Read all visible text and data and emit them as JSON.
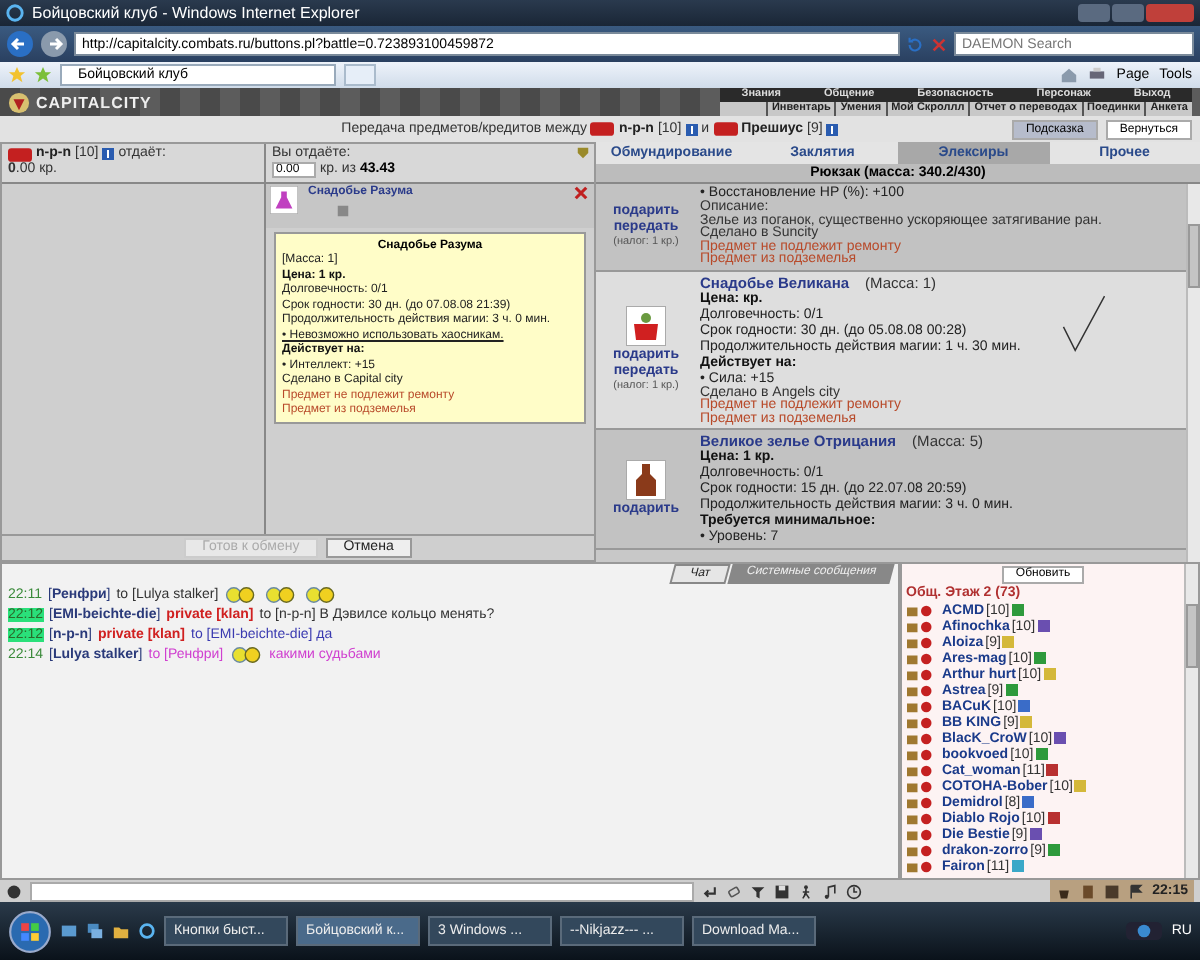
{
  "browser": {
    "title": "Бойцовский клуб - Windows Internet Explorer",
    "url": "http://capitalcity.combats.ru/buttons.pl?battle=0.723893100459872",
    "search_placeholder": "DAEMON Search",
    "tab": "Бойцовский клуб",
    "tools": [
      "Page",
      "Tools"
    ]
  },
  "game": {
    "logo": "CAPITALCITY",
    "nav_top": [
      "Знания",
      "Общение",
      "Безопасность",
      "Персонаж",
      "Выход"
    ],
    "nav_bottom": [
      "Инвентарь",
      "Умения",
      "Мой Скроллл",
      "Отчет о переводах",
      "Поединки",
      "Анкета"
    ]
  },
  "transfer": {
    "title": "Передача предметов/кредитов между",
    "user1": {
      "name": "n-p-n",
      "level": "[10]"
    },
    "conj": "и",
    "user2": {
      "name": "Прешиус",
      "level": "[9]"
    },
    "buttons": [
      "Подсказка",
      "Вернуться"
    ]
  },
  "partner": {
    "name": "n-p-n",
    "level": "[10]",
    "label": "отдаёт:",
    "amount": "**0**.00 кр."
  },
  "mine": {
    "label": "Вы отдаёте:",
    "value": "0.00",
    "of_label": "кр. из",
    "balance": "43.43",
    "item": "Снадобье Разума",
    "tooltip": {
      "title": "Снадобье Разума",
      "lines": [
        {
          "kind": "plain",
          "text": "[Масса: 1]"
        },
        {
          "kind": "bold",
          "text": "Цена: 1 кр."
        },
        {
          "kind": "plain",
          "text": "Долговечность: 0/1"
        },
        {
          "kind": "plain",
          "text": "Срок годности: 30 дн. (до 07.08.08 21:39)"
        },
        {
          "kind": "plain",
          "text": "Продолжительность действия магии: 3 ч. 0 мин."
        },
        {
          "kind": "underline",
          "text": "• Невозможно использовать хаосникам."
        },
        {
          "kind": "bold",
          "text": "Действует на:"
        },
        {
          "kind": "plain",
          "text": "• Интеллект: +15"
        },
        {
          "kind": "plain",
          "text": "Сделано в Capital city"
        },
        {
          "kind": "red",
          "text": "Предмет не подлежит ремонту"
        },
        {
          "kind": "red",
          "text": "Предмет из подземелья"
        }
      ]
    }
  },
  "trade_buttons": [
    {
      "label": "Готов к обмену",
      "disabled": true
    },
    {
      "label": "Отмена",
      "disabled": false
    }
  ],
  "inventory": {
    "tabs": [
      {
        "label": "Обмундирование",
        "selected": false
      },
      {
        "label": "Заклятия",
        "selected": false
      },
      {
        "label": "Элексиры",
        "selected": true
      },
      {
        "label": "Прочее",
        "selected": false
      }
    ],
    "header": "Рюкзак (масса: 340.2/430)",
    "items": [
      {
        "kind": "plain",
        "actions": [
          "подарить",
          "передать"
        ],
        "tax": "(налог: 1 кр.)",
        "checked": false,
        "lines": [
          {
            "kind": "plain",
            "text": "• Восстановление HP (%): +100"
          },
          {
            "kind": "small",
            "text": "Описание:"
          },
          {
            "kind": "small",
            "text": "Зелье из поганок, существенно ускоряющее затягивание ран."
          },
          {
            "kind": "small",
            "text": "Сделано в Suncity"
          },
          {
            "kind": "red",
            "text": "Предмет не подлежит ремонту"
          },
          {
            "kind": "red",
            "text": "Предмет из подземелья"
          }
        ]
      },
      {
        "name": "Снадобье Великана",
        "mass": "(Масса: 1)",
        "kind": "bag",
        "actions": [
          "подарить",
          "передать"
        ],
        "tax": "(налог: 1 кр.)",
        "checked": true,
        "lines": [
          {
            "kind": "bold",
            "text": "Цена: кр."
          },
          {
            "kind": "plain",
            "text": "Долговечность: 0/1"
          },
          {
            "kind": "plain",
            "text": "Срок годности: 30 дн. (до 05.08.08 00:28)"
          },
          {
            "kind": "plain",
            "text": "Продолжительность действия магии: 1 ч. 30 мин."
          },
          {
            "kind": "bold",
            "text": "Действует на:"
          },
          {
            "kind": "plain",
            "text": "• Сила: +15"
          },
          {
            "kind": "small",
            "text": "Сделано в Angels city"
          },
          {
            "kind": "red",
            "text": "Предмет не подлежит ремонту"
          },
          {
            "kind": "red",
            "text": "Предмет из подземелья"
          }
        ]
      },
      {
        "name": "Великое зелье Отрицания",
        "mass": "(Масса: 5)",
        "kind": "bottle",
        "actions": [
          "подарить"
        ],
        "checked": false,
        "lines": [
          {
            "kind": "bold",
            "text": "Цена: 1 кр."
          },
          {
            "kind": "plain",
            "text": "Долговечность: 0/1"
          },
          {
            "kind": "plain",
            "text": "Срок годности: 15 дн. (до 22.07.08 20:59)"
          },
          {
            "kind": "plain",
            "text": "Продолжительность действия магии: 3 ч. 0 мин."
          },
          {
            "kind": "bold",
            "text": "Требуется минимальное:"
          },
          {
            "kind": "plain",
            "text": "• Уровень: 7"
          }
        ]
      }
    ]
  },
  "chat": {
    "tabs": [
      {
        "label": "Чат",
        "selected": true
      },
      {
        "label": "Системные сообщения",
        "selected": false
      }
    ],
    "messages": [
      {
        "time": "22:11",
        "highlighted": false,
        "parts": [
          {
            "kind": "name",
            "text": "[**Ренфри**]"
          },
          {
            "kind": "text",
            "text": "to [Lulya stalker]"
          },
          {
            "kind": "smiley"
          },
          {
            "kind": "smiley"
          },
          {
            "kind": "smiley"
          }
        ]
      },
      {
        "time": "22:12",
        "highlighted": true,
        "parts": [
          {
            "kind": "name",
            "text": "[**EMI-beichte-die**]"
          },
          {
            "kind": "private",
            "text": "private [klan]"
          },
          {
            "kind": "text",
            "text": "to [n-p-n] В Дэвилсе кольцо менять?"
          }
        ]
      },
      {
        "time": "22:12",
        "highlighted": true,
        "parts": [
          {
            "kind": "name",
            "text": "[**n-p-n**]"
          },
          {
            "kind": "private",
            "text": "private [klan]"
          },
          {
            "kind": "blue",
            "text": "to [EMI-beichte-die] да"
          }
        ]
      },
      {
        "time": "22:14",
        "highlighted": false,
        "parts": [
          {
            "kind": "name",
            "text": "[**Lulya stalker**]"
          },
          {
            "kind": "pink",
            "text": "to [Ренфри]"
          },
          {
            "kind": "smiley"
          },
          {
            "kind": "pink",
            "text": "какими судьбами"
          }
        ]
      }
    ]
  },
  "users": {
    "refresh": "Обновить",
    "room": "Общ. Этаж 2 (73)",
    "list": [
      {
        "name": "ACMD",
        "level": "[10]",
        "color": "#2e9a3c"
      },
      {
        "name": "Afinochka",
        "level": "[10]",
        "color": "#6a4fb0"
      },
      {
        "name": "Aloiza",
        "level": "[9]",
        "color": "#d4b83a"
      },
      {
        "name": "Ares-mag",
        "level": "[10]",
        "color": "#2e9a3c"
      },
      {
        "name": "Arthur hurt",
        "level": "[10]",
        "color": "#d4b83a"
      },
      {
        "name": "Astrea",
        "level": "[9]",
        "color": "#2e9a3c"
      },
      {
        "name": "BACuK",
        "level": "[10]",
        "color": "#3a6cc8"
      },
      {
        "name": "BB KING",
        "level": "[9]",
        "color": "#d4b83a"
      },
      {
        "name": "BlacK_CroW",
        "level": "[10]",
        "color": "#6a4fb0"
      },
      {
        "name": "bookvoed",
        "level": "[10]",
        "color": "#2e9a3c"
      },
      {
        "name": "Cat_woman",
        "level": "[11]",
        "color": "#b83030"
      },
      {
        "name": "COTOHA-Bober",
        "level": "[10]",
        "color": "#d4b83a"
      },
      {
        "name": "Demidrol",
        "level": "[8]",
        "color": "#3a6cc8"
      },
      {
        "name": "Diablo Rojo",
        "level": "[10]",
        "color": "#b83030"
      },
      {
        "name": "Die Bestie",
        "level": "[9]",
        "color": "#6a4fb0"
      },
      {
        "name": "drakon-zorro",
        "level": "[9]",
        "color": "#2e9a3c"
      },
      {
        "name": "Fairon",
        "level": "[11]",
        "color": "#3aa8c8"
      }
    ]
  },
  "clock": "22:15",
  "taskbar": {
    "tasks": [
      {
        "label": "Кнопки быст...",
        "selected": false
      },
      {
        "label": "Бойцовский к...",
        "selected": true
      },
      {
        "label": "3 Windows ...",
        "selected": false
      },
      {
        "label": "--Nikjazz--- ...",
        "selected": false
      },
      {
        "label": "Download Ma...",
        "selected": false
      }
    ],
    "lang": "RU"
  }
}
